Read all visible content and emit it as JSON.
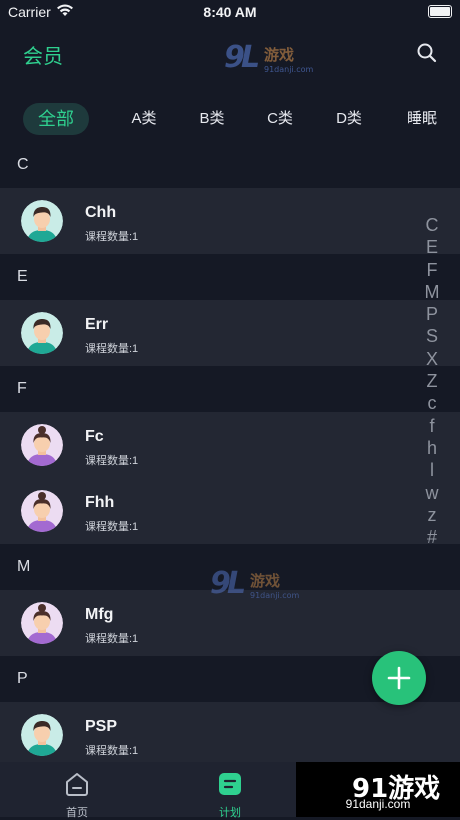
{
  "status_bar": {
    "carrier": "Carrier",
    "time": "8:40 AM"
  },
  "header": {
    "title": "会员"
  },
  "watermark": {
    "logo_text": "91游戏",
    "site": "91danji.com"
  },
  "tabs": [
    {
      "label": "全部",
      "active": true
    },
    {
      "label": "A类",
      "active": false
    },
    {
      "label": "B类",
      "active": false
    },
    {
      "label": "C类",
      "active": false
    },
    {
      "label": "D类",
      "active": false
    },
    {
      "label": "睡眠",
      "active": false
    }
  ],
  "sections": [
    {
      "letter": "C",
      "members": [
        {
          "name": "Chh",
          "course_count": "课程数量:1",
          "avatar": "male-avatar"
        }
      ]
    },
    {
      "letter": "E",
      "members": [
        {
          "name": "Err",
          "course_count": "课程数量:1",
          "avatar": "male-avatar"
        }
      ]
    },
    {
      "letter": "F",
      "members": [
        {
          "name": "Fc",
          "course_count": "课程数量:1",
          "avatar": "female-avatar"
        },
        {
          "name": "Fhh",
          "course_count": "课程数量:1",
          "avatar": "female-avatar"
        }
      ]
    },
    {
      "letter": "M",
      "members": [
        {
          "name": "Mfg",
          "course_count": "课程数量:1",
          "avatar": "female-avatar"
        }
      ]
    },
    {
      "letter": "P",
      "members": [
        {
          "name": "PSP",
          "course_count": "课程数量:1",
          "avatar": "male-avatar"
        }
      ]
    }
  ],
  "index_letters": [
    "C",
    "E",
    "F",
    "M",
    "P",
    "S",
    "X",
    "Z",
    "c",
    "f",
    "h",
    "l",
    "w",
    "z",
    "#"
  ],
  "tabbar": {
    "items": [
      {
        "label": "首页",
        "active": false
      },
      {
        "label": "计划",
        "active": true
      }
    ]
  },
  "colors": {
    "accent": "#2fd08f",
    "background": "#151925",
    "row": "#232733",
    "fab": "#28c27a"
  }
}
